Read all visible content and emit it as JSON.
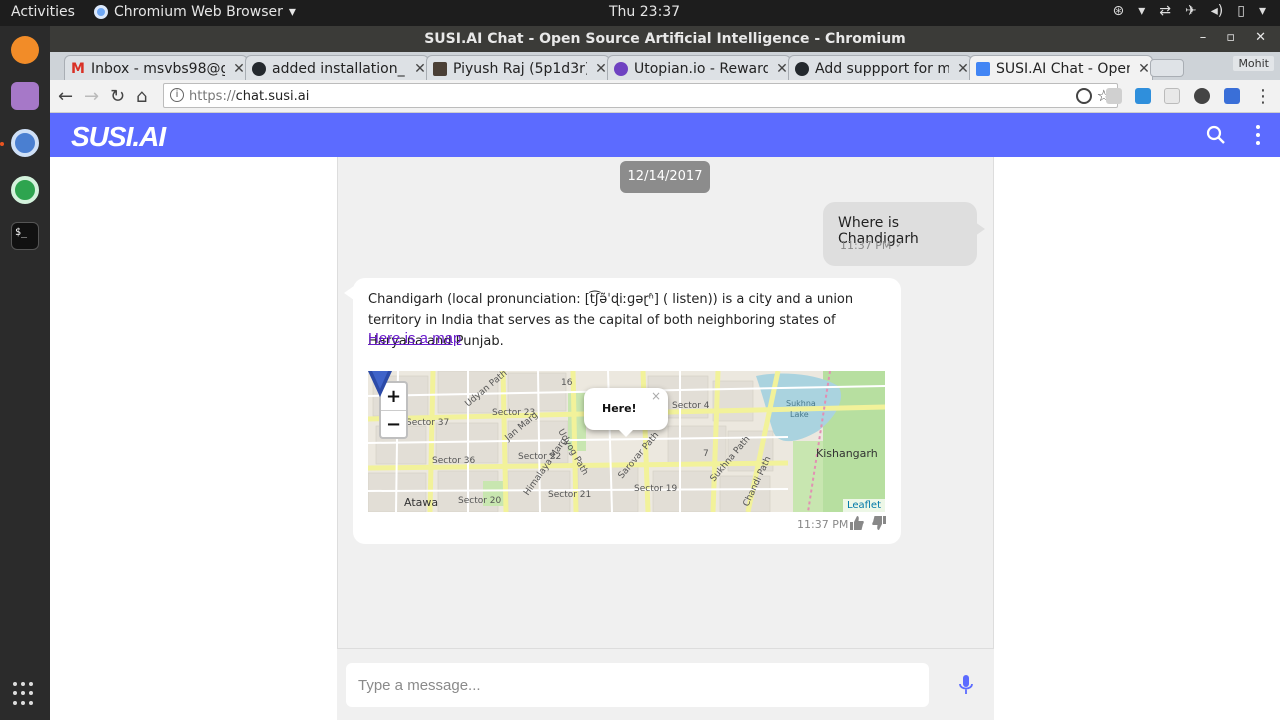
{
  "os": {
    "activities": "Activities",
    "app_menu": "Chromium Web Browser",
    "clock": "Thu 23:37"
  },
  "window": {
    "title": "SUSI.AI Chat - Open Source Artificial Intelligence - Chromium"
  },
  "tabs": [
    {
      "title": "Inbox - msvbs98@g",
      "favicon": "gmail-icon",
      "color": "#d93025"
    },
    {
      "title": "added installation_",
      "favicon": "github-icon",
      "color": "#24292e"
    },
    {
      "title": "Piyush Raj (5p1d3r)",
      "favicon": "steemit-icon",
      "color": "#4a3f35"
    },
    {
      "title": "Utopian.io - Reward",
      "favicon": "utopian-icon",
      "color": "#6f42c1"
    },
    {
      "title": "Add suppport for m",
      "favicon": "github-icon",
      "color": "#24292e"
    },
    {
      "title": "SUSI.AI Chat - Open",
      "favicon": "susi-icon",
      "color": "#4285f4"
    }
  ],
  "profile": "Mohit",
  "address_bar": {
    "scheme": "https://",
    "host": "chat.susi.ai"
  },
  "app": {
    "logo": "SUSI.AI",
    "brand_color": "#5c6bff"
  },
  "chat": {
    "date": "12/14/2017",
    "user_message": {
      "text": "Where is Chandigarh",
      "time": "11:37 PM"
    },
    "susi_message": {
      "text": "Chandigarh (local pronunciation: [t͡ʃə̃ˈɖiːɡəɽʱ] ( listen)) is a city and a union territory in India that serves as the capital of both neighboring states of Haryana and Punjab.",
      "link": "Here is a map",
      "time": "11:37 PM"
    },
    "map": {
      "popup": "Here!",
      "close": "×",
      "zoom_in": "+",
      "zoom_out": "−",
      "attribution": "Leaflet",
      "labels": {
        "sector16": "16",
        "sector4": "Sector 4",
        "sector7": "7",
        "sukhna": "Sukhna",
        "lake": "Lake",
        "kishangarh": "Kishangarh",
        "sector23": "Sector 23",
        "sector37": "Sector 37",
        "sector36": "Sector 36",
        "sector22": "Sector 22",
        "sector20": "Sector 20",
        "sector19": "Sector 19",
        "sector21": "Sector 21",
        "atawa": "Atawa",
        "jan_marg": "Jan Marg",
        "udyan_path": "Udyan Path",
        "himalaya_marg": "Himalaya Marg",
        "sarovar_path": "Sarovar Path",
        "sukhna_path": "Sukhna Path",
        "chandi_path": "Chandi Path",
        "uddyog_path": "Udyog Path"
      }
    },
    "input_placeholder": "Type a message..."
  }
}
